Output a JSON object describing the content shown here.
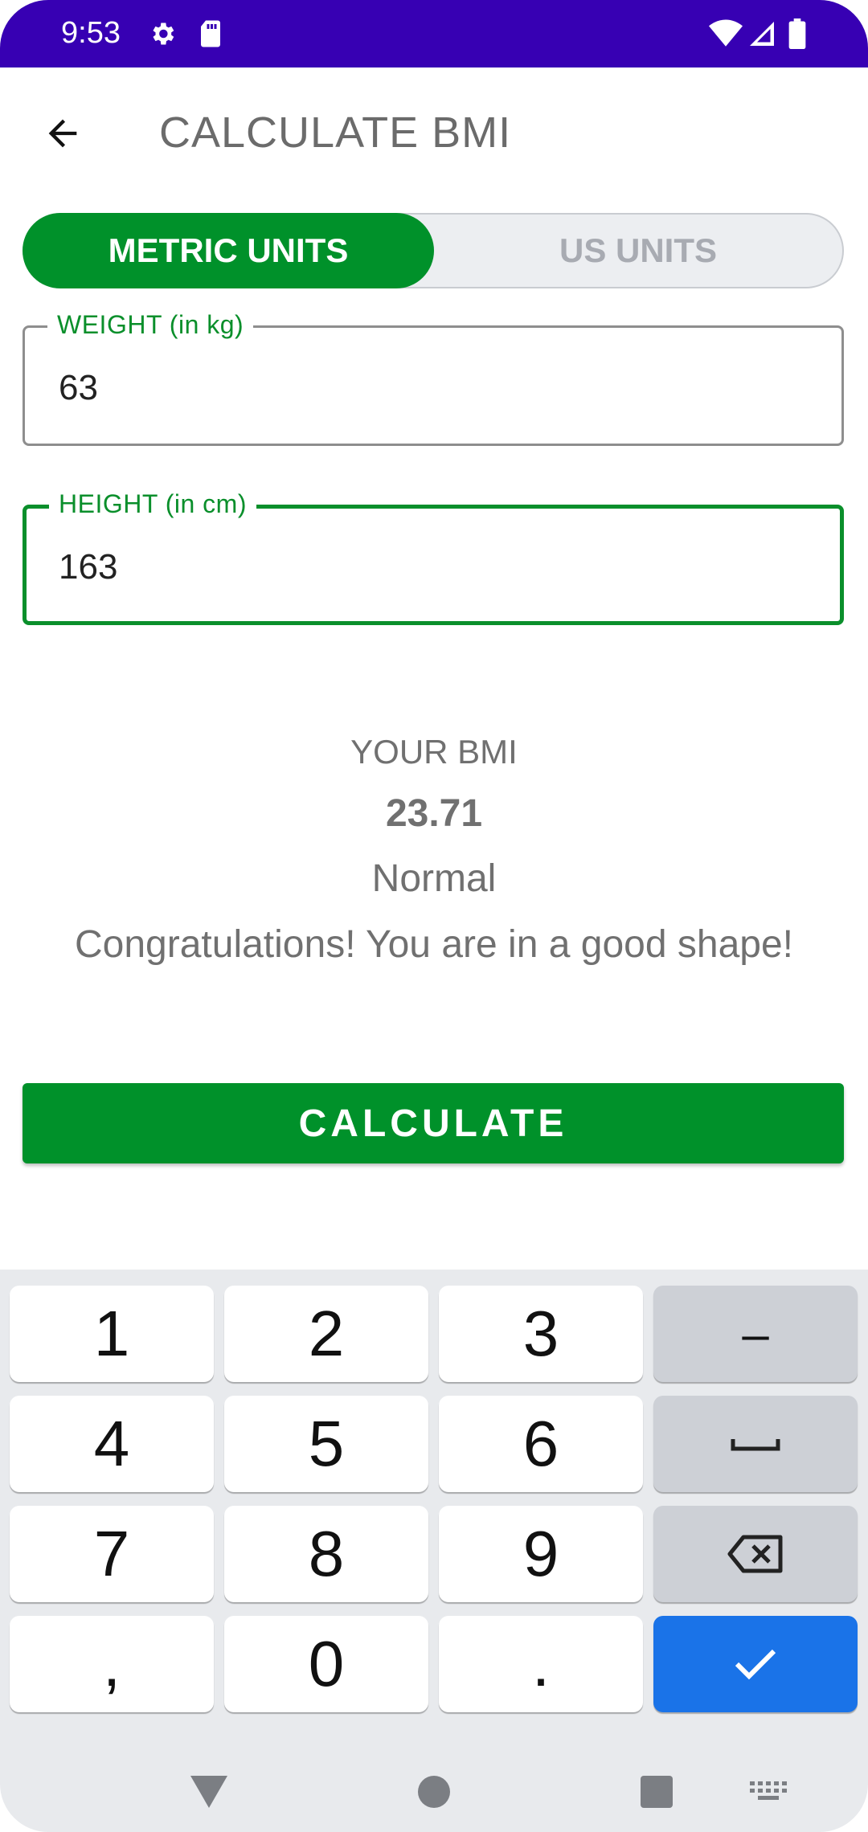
{
  "status_bar": {
    "time": "9:53",
    "icons": [
      "settings-icon",
      "sd-card-icon",
      "wifi-icon",
      "signal-icon",
      "battery-icon"
    ]
  },
  "app_bar": {
    "title": "CALCULATE BMI",
    "back_icon": "arrow-left-icon"
  },
  "unit_toggle": {
    "metric_label": "METRIC UNITS",
    "us_label": "US UNITS",
    "selected": "metric"
  },
  "form": {
    "weight_label": "WEIGHT (in kg)",
    "weight_value": "63",
    "height_label": "HEIGHT (in cm)",
    "height_value": "163"
  },
  "result": {
    "heading": "YOUR BMI",
    "value": "23.71",
    "category": "Normal",
    "message": "Congratulations! You are in a good shape!"
  },
  "calculate_button": {
    "label": "CALCULATE"
  },
  "keyboard": {
    "rows": [
      [
        "1",
        "2",
        "3",
        "–"
      ],
      [
        "4",
        "5",
        "6",
        "space"
      ],
      [
        "7",
        "8",
        "9",
        "backspace"
      ],
      [
        ",",
        "0",
        ".",
        "done"
      ]
    ]
  },
  "colors": {
    "status_bar": "#3700b3",
    "accent_green": "#00912a",
    "done_key": "#1a73e8"
  }
}
